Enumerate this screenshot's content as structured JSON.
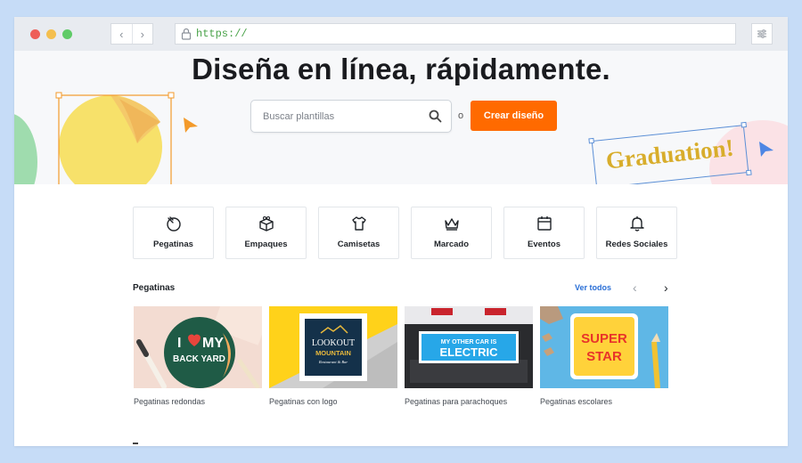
{
  "browser": {
    "url": "https://",
    "back_label": "‹",
    "forward_label": "›"
  },
  "hero": {
    "title": "Diseña en línea, rápidamente.",
    "search_placeholder": "Buscar plantillas",
    "or_text": "o",
    "create_button": "Crear diseño",
    "graduation_text": "Graduation!"
  },
  "categories": [
    {
      "label": "Pegatinas",
      "icon": "sticker-icon"
    },
    {
      "label": "Empaques",
      "icon": "package-icon"
    },
    {
      "label": "Camisetas",
      "icon": "tshirt-icon"
    },
    {
      "label": "Marcado",
      "icon": "crown-icon"
    },
    {
      "label": "Eventos",
      "icon": "calendar-icon"
    },
    {
      "label": "Redes Sociales",
      "icon": "bell-icon"
    }
  ],
  "section": {
    "title": "Pegatinas",
    "see_all": "Ver todos",
    "prev": "‹",
    "next": "›"
  },
  "cards": [
    {
      "caption": "Pegatinas redondas",
      "image_text_1": "I",
      "image_text_2": "MY",
      "image_text_3": "BACK YARD"
    },
    {
      "caption": "Pegatinas con logo",
      "image_text_1": "LOOKOUT",
      "image_text_2": "MOUNTAIN",
      "image_text_3": "Restaurant & Bar"
    },
    {
      "caption": "Pegatinas para parachoques",
      "image_text_1": "MY OTHER CAR IS",
      "image_text_2": "ELECTRIC"
    },
    {
      "caption": "Pegatinas escolares",
      "image_text_1": "SUPER",
      "image_text_2": "STAR"
    }
  ],
  "colors": {
    "accent": "#ff6a00",
    "link": "#2a6fd6",
    "graduation": "#d8ad2b"
  }
}
